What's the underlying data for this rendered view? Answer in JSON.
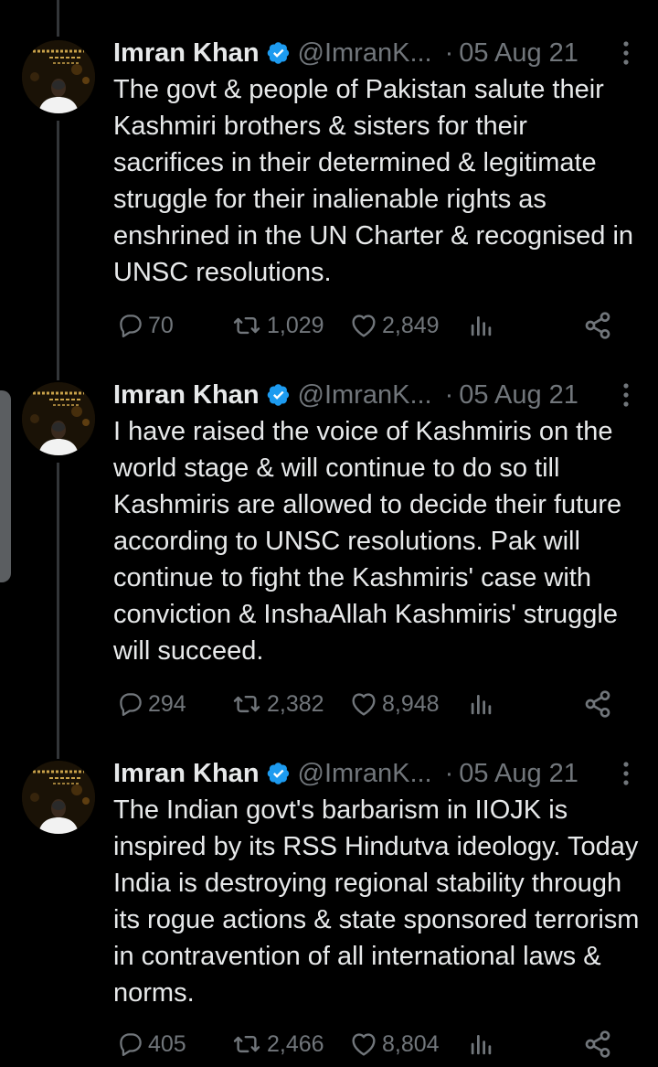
{
  "colors": {
    "background": "#000000",
    "text": "#e7e9ea",
    "secondary": "#71767b",
    "verified": "#1d9bf0",
    "thread_line": "#333639"
  },
  "tweets": [
    {
      "author_name": "Imran Khan",
      "handle": "@ImranK...",
      "separator": "·",
      "date": "05 Aug 21",
      "verified_icon": "verified-badge-icon",
      "text": "The govt & people of Pakistan salute their Kashmiri brothers & sisters for their sacrifices in their determined & legitimate struggle for their inalienable rights as enshrined in the UN Charter & recognised in UNSC resolutions.",
      "replies": "70",
      "retweets": "1,029",
      "likes": "2,849"
    },
    {
      "author_name": "Imran Khan",
      "handle": "@ImranK...",
      "separator": "·",
      "date": "05 Aug 21",
      "verified_icon": "verified-badge-icon",
      "text": "I have raised the voice of Kashmiris on the world stage & will continue to do so till Kashmiris are allowed to decide their future according to UNSC resolutions. Pak will continue to fight the Kashmiris' case with conviction & InshaAllah Kashmiris' struggle will succeed.",
      "replies": "294",
      "retweets": "2,382",
      "likes": "8,948"
    },
    {
      "author_name": "Imran Khan",
      "handle": "@ImranK...",
      "separator": "·",
      "date": "05 Aug 21",
      "verified_icon": "verified-badge-icon",
      "text": "The Indian govt's barbarism in IIOJK is inspired by its RSS Hindutva ideology. Today India is destroying regional stability through its rogue actions & state sponsored terrorism in contravention of all international laws & norms.",
      "replies": "405",
      "retweets": "2,466",
      "likes": "8,804"
    }
  ]
}
